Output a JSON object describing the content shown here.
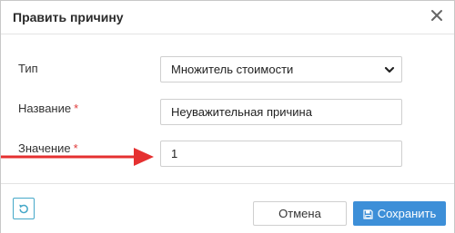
{
  "dialog": {
    "title": "Править причину"
  },
  "form": {
    "type": {
      "label": "Тип",
      "value": "Множитель стоимости"
    },
    "name": {
      "label": "Название",
      "required_mark": "*",
      "value": "Неуважительная причина"
    },
    "value": {
      "label": "Значение",
      "required_mark": "*",
      "value": "1"
    }
  },
  "footer": {
    "cancel_label": "Отмена",
    "save_label": "Сохранить"
  },
  "icons": {
    "close": "close-icon",
    "dropdown": "chevron-down-icon",
    "reset": "undo-icon",
    "save": "floppy-disk-icon",
    "annotation": "arrow-right-icon"
  },
  "colors": {
    "primary": "#3d8fd8",
    "reset_border": "#45a8c8",
    "required": "#e03a3a",
    "annotation_arrow": "#e53030"
  }
}
